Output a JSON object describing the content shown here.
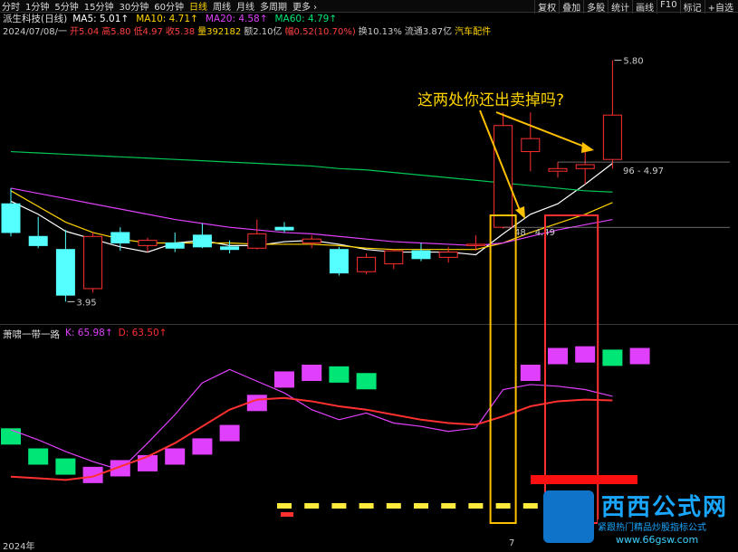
{
  "periods": [
    "分时",
    "1分钟",
    "5分钟",
    "15分钟",
    "30分钟",
    "60分钟",
    "日线",
    "周线",
    "月线",
    "多周期",
    "更多 ›"
  ],
  "active_period": "日线",
  "right_menu": [
    "复权",
    "叠加",
    "多股",
    "统计",
    "画线",
    "F10",
    "标记",
    "+自选"
  ],
  "header": {
    "title": "派生科技(日线)",
    "ma_labels": [
      {
        "text": "MA5: 5.01↑",
        "color": "#ffffff"
      },
      {
        "text": "MA10: 4.71↑",
        "color": "#ffd400"
      },
      {
        "text": "MA20: 4.58↑",
        "color": "#e040fb"
      },
      {
        "text": "MA60: 4.79↑",
        "color": "#00e676"
      }
    ]
  },
  "quote": [
    {
      "text": "2024/07/08/一",
      "color": "#cccccc"
    },
    {
      "text": "开5.04",
      "color": "#ff4040"
    },
    {
      "text": "高5.80",
      "color": "#ff4040"
    },
    {
      "text": "低4.97",
      "color": "#ff4040"
    },
    {
      "text": "收5.38",
      "color": "#ff4040"
    },
    {
      "text": "量392182",
      "color": "#ffd400"
    },
    {
      "text": "额2.10亿",
      "color": "#cccccc"
    },
    {
      "text": "幅0.52(10.70%)",
      "color": "#ff4040"
    },
    {
      "text": "换10.13%",
      "color": "#cccccc"
    },
    {
      "text": "流通3.87亿",
      "color": "#cccccc"
    },
    {
      "text": "汽车配件",
      "color": "#ffd400"
    }
  ],
  "indicator": {
    "name": "萧啸一带一路",
    "k": "K: 65.98↑",
    "d": "D: 63.50↑",
    "colors": {
      "k": "#e040fb",
      "d": "#ff3030"
    }
  },
  "annotation": "这两处你还出卖掉吗?",
  "footer": {
    "year": "2024年",
    "mark": "7"
  },
  "watermark": {
    "title": "西西公式网",
    "subtitle": "紧跟热门精品炒股指标公式",
    "url": "www.66gsw.com"
  },
  "chart_data": {
    "type": "candlestick",
    "price_labels": {
      "high": "5.80",
      "low": "3.95",
      "range_a": "96 - 4.97",
      "range_b": "48 - 4.49"
    },
    "candles": [
      {
        "o": 4.7,
        "h": 4.82,
        "l": 4.45,
        "c": 4.48
      },
      {
        "o": 4.45,
        "h": 4.6,
        "l": 4.36,
        "c": 4.38
      },
      {
        "o": 4.35,
        "h": 4.5,
        "l": 3.95,
        "c": 4.0
      },
      {
        "o": 4.05,
        "h": 4.48,
        "l": 4.02,
        "c": 4.45
      },
      {
        "o": 4.48,
        "h": 4.52,
        "l": 4.34,
        "c": 4.4
      },
      {
        "o": 4.38,
        "h": 4.44,
        "l": 4.33,
        "c": 4.42
      },
      {
        "o": 4.4,
        "h": 4.48,
        "l": 4.33,
        "c": 4.36
      },
      {
        "o": 4.46,
        "h": 4.55,
        "l": 4.36,
        "c": 4.37
      },
      {
        "o": 4.37,
        "h": 4.42,
        "l": 4.32,
        "c": 4.35
      },
      {
        "o": 4.36,
        "h": 4.58,
        "l": 4.35,
        "c": 4.47
      },
      {
        "o": 4.52,
        "h": 4.56,
        "l": 4.48,
        "c": 4.5
      },
      {
        "o": 4.4,
        "h": 4.46,
        "l": 4.36,
        "c": 4.43
      },
      {
        "o": 4.35,
        "h": 4.37,
        "l": 4.15,
        "c": 4.17
      },
      {
        "o": 4.18,
        "h": 4.32,
        "l": 4.16,
        "c": 4.29
      },
      {
        "o": 4.24,
        "h": 4.35,
        "l": 4.2,
        "c": 4.34
      },
      {
        "o": 4.34,
        "h": 4.4,
        "l": 4.26,
        "c": 4.28
      },
      {
        "o": 4.29,
        "h": 4.37,
        "l": 4.25,
        "c": 4.33
      },
      {
        "o": 4.38,
        "h": 4.46,
        "l": 4.34,
        "c": 4.39
      },
      {
        "o": 4.52,
        "h": 5.4,
        "l": 4.51,
        "c": 5.3
      },
      {
        "o": 5.1,
        "h": 5.4,
        "l": 4.95,
        "c": 5.2
      },
      {
        "o": 4.95,
        "h": 5.02,
        "l": 4.9,
        "c": 4.97
      },
      {
        "o": 4.97,
        "h": 5.1,
        "l": 4.85,
        "c": 5.0
      },
      {
        "o": 5.04,
        "h": 5.8,
        "l": 4.97,
        "c": 5.38
      }
    ],
    "ma": {
      "MA5": [
        4.72,
        4.62,
        4.49,
        4.43,
        4.37,
        4.33,
        4.4,
        4.42,
        4.38,
        4.38,
        4.41,
        4.42,
        4.39,
        4.35,
        4.33,
        4.33,
        4.33,
        4.31,
        4.47,
        4.62,
        4.7,
        4.85,
        5.01
      ],
      "MA10": [
        4.8,
        4.68,
        4.56,
        4.48,
        4.43,
        4.4,
        4.4,
        4.4,
        4.4,
        4.39,
        4.39,
        4.39,
        4.38,
        4.36,
        4.35,
        4.35,
        4.35,
        4.35,
        4.4,
        4.48,
        4.55,
        4.62,
        4.71
      ],
      "MA20": [
        4.82,
        4.78,
        4.74,
        4.7,
        4.66,
        4.62,
        4.58,
        4.55,
        4.52,
        4.5,
        4.48,
        4.47,
        4.45,
        4.43,
        4.41,
        4.4,
        4.39,
        4.38,
        4.4,
        4.45,
        4.5,
        4.54,
        4.58
      ],
      "MA60": [
        5.1,
        5.09,
        5.08,
        5.07,
        5.06,
        5.05,
        5.04,
        5.03,
        5.02,
        5.01,
        5.0,
        4.99,
        4.97,
        4.96,
        4.94,
        4.92,
        4.9,
        4.88,
        4.86,
        4.84,
        4.82,
        4.8,
        4.79
      ]
    },
    "kd": {
      "K": [
        46,
        40,
        33,
        27,
        22,
        38,
        55,
        74,
        82,
        75,
        68,
        58,
        52,
        56,
        50,
        48,
        45,
        47,
        70,
        73,
        72,
        70,
        65.98
      ],
      "D": [
        18,
        17,
        16,
        18,
        24,
        30,
        38,
        48,
        58,
        64,
        65,
        63,
        60,
        58,
        55,
        52,
        50,
        49,
        54,
        60,
        63,
        64,
        63.5
      ]
    },
    "trend_boxes": [
      {
        "i": 0,
        "v": 42,
        "color": "#00e676"
      },
      {
        "i": 1,
        "v": 30,
        "color": "#00e676"
      },
      {
        "i": 2,
        "v": 24,
        "color": "#00e676"
      },
      {
        "i": 3,
        "v": 19,
        "color": "#e040fb"
      },
      {
        "i": 4,
        "v": 23,
        "color": "#e040fb"
      },
      {
        "i": 5,
        "v": 26,
        "color": "#e040fb"
      },
      {
        "i": 6,
        "v": 30,
        "color": "#e040fb"
      },
      {
        "i": 7,
        "v": 36,
        "color": "#e040fb"
      },
      {
        "i": 8,
        "v": 44,
        "color": "#e040fb"
      },
      {
        "i": 9,
        "v": 62,
        "color": "#e040fb"
      },
      {
        "i": 10,
        "v": 76,
        "color": "#e040fb"
      },
      {
        "i": 11,
        "v": 80,
        "color": "#e040fb"
      },
      {
        "i": 12,
        "v": 79,
        "color": "#00e676"
      },
      {
        "i": 13,
        "v": 75,
        "color": "#00e676"
      },
      {
        "i": 19,
        "v": 80,
        "color": "#e040fb"
      },
      {
        "i": 20,
        "v": 90,
        "color": "#e040fb"
      },
      {
        "i": 21,
        "v": 91,
        "color": "#e040fb"
      },
      {
        "i": 22,
        "v": 89,
        "color": "#00e676"
      },
      {
        "i": 23,
        "v": 90,
        "color": "#e040fb"
      }
    ],
    "signal_dashes_yellow": [
      10,
      11,
      12,
      13,
      14,
      15,
      16,
      17,
      18,
      19,
      20
    ],
    "highlight_boxes": [
      {
        "from": 18,
        "to": 18,
        "color": "#ffc000"
      },
      {
        "from": 20,
        "to": 21,
        "color": "#ff3030"
      }
    ]
  }
}
